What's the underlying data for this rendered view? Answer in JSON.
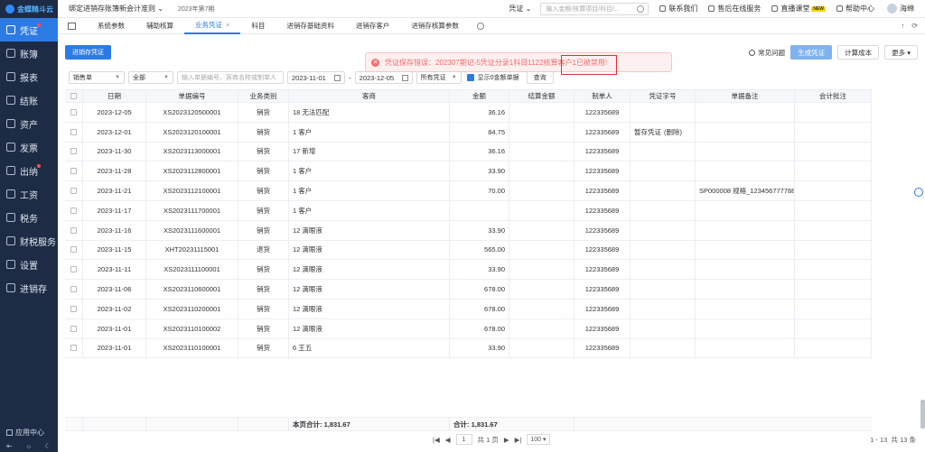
{
  "sidebar": {
    "logo": "金蝶精斗云",
    "items": [
      {
        "label": "凭证",
        "icon": "voucher-icon",
        "active": true,
        "dot": true
      },
      {
        "label": "账簿",
        "icon": "ledger-icon"
      },
      {
        "label": "报表",
        "icon": "report-icon"
      },
      {
        "label": "结账",
        "icon": "close-account-icon"
      },
      {
        "label": "资产",
        "icon": "asset-icon"
      },
      {
        "label": "发票",
        "icon": "invoice-icon"
      },
      {
        "label": "出纳",
        "icon": "cashier-icon",
        "dot": true
      },
      {
        "label": "工资",
        "icon": "salary-icon"
      },
      {
        "label": "税务",
        "icon": "tax-icon"
      },
      {
        "label": "财税服务",
        "icon": "service-icon"
      },
      {
        "label": "设置",
        "icon": "settings-icon"
      },
      {
        "label": "进销存",
        "icon": "inventory-icon"
      }
    ],
    "app_center": "应用中心"
  },
  "topbar": {
    "company": "绑定进销存账簿新会计准则",
    "period": "2023年第7期",
    "voucher_select": "凭证",
    "search_placeholder": "输入金额/核算项目/科目/...",
    "links": [
      "联系我们",
      "售后在线服务",
      "直播课堂",
      "帮助中心"
    ],
    "new_badge": "NEW",
    "user": "海绵"
  },
  "tabs": [
    {
      "label": "系统参数"
    },
    {
      "label": "辅助核算"
    },
    {
      "label": "业务凭证",
      "active": true,
      "close": "×"
    },
    {
      "label": "科目"
    },
    {
      "label": "进销存基础资料"
    },
    {
      "label": "进销存客户"
    },
    {
      "label": "进销存核算参数"
    }
  ],
  "toolbar": {
    "inventory_voucher": "进销存凭证",
    "faq": "常见问题",
    "generate": "生成凭证",
    "cost": "计算成本",
    "more": "更多"
  },
  "toast": {
    "message": "凭证保存错误：202307期记-5凭证分录1科目1122核算客户1已被禁用!"
  },
  "filters": {
    "type": "销售单",
    "scope": "全部",
    "search_placeholder": "输入单据编号、客商名称或制单人",
    "date_from": "2023-11-01",
    "date_sep": "-",
    "date_to": "2023-12-05",
    "status": "所有凭证",
    "show_zero": "显示0金额单据",
    "query": "查询"
  },
  "table": {
    "headers": [
      "日期",
      "单据编号",
      "业务类别",
      "客商",
      "金额",
      "结算金额",
      "制单人",
      "凭证字号",
      "单据备注",
      "会计批注"
    ],
    "rows": [
      {
        "date": "2023-12-05",
        "no": "XS2023120500001",
        "cat": "销货",
        "party": "18 无法匹配",
        "amount": "36.16",
        "settle": "",
        "maker": "122335689",
        "voucher": "",
        "note": "",
        "audit": ""
      },
      {
        "date": "2023-12-01",
        "no": "XS2023120100001",
        "cat": "销货",
        "party": "1 客户",
        "amount": "84.75",
        "settle": "",
        "maker": "122335689",
        "voucher": "暂存凭证",
        "voucher_del": "(删除)",
        "note": "",
        "audit": ""
      },
      {
        "date": "2023-11-30",
        "no": "XS2023113000001",
        "cat": "销货",
        "party": "17 新增",
        "amount": "36.16",
        "settle": "",
        "maker": "122335689",
        "voucher": "",
        "note": "",
        "audit": ""
      },
      {
        "date": "2023-11-28",
        "no": "XS2023112800001",
        "cat": "销货",
        "party": "1 客户",
        "amount": "33.90",
        "settle": "",
        "maker": "122335689",
        "voucher": "",
        "note": "",
        "audit": ""
      },
      {
        "date": "2023-11-21",
        "no": "XS2023112100001",
        "cat": "销货",
        "party": "1 客户",
        "amount": "70.00",
        "settle": "",
        "maker": "122335689",
        "voucher": "",
        "note": "SP000008 规格_123456777788",
        "audit": ""
      },
      {
        "date": "2023-11-17",
        "no": "XS2023111700001",
        "cat": "销货",
        "party": "1 客户",
        "amount": "",
        "settle": "",
        "maker": "122335689",
        "voucher": "",
        "note": "",
        "audit": ""
      },
      {
        "date": "2023-11-16",
        "no": "XS2023111600001",
        "cat": "销货",
        "party": "12 滴眼液",
        "amount": "33.90",
        "settle": "",
        "maker": "122335689",
        "voucher": "",
        "note": "",
        "audit": ""
      },
      {
        "date": "2023-11-15",
        "no": "XHT20231115001",
        "cat": "退货",
        "party": "12 滴眼液",
        "amount": "565.00",
        "settle": "",
        "maker": "122335689",
        "voucher": "",
        "note": "",
        "audit": ""
      },
      {
        "date": "2023-11-11",
        "no": "XS2023111100001",
        "cat": "销货",
        "party": "12 滴眼液",
        "amount": "33.90",
        "settle": "",
        "maker": "122335689",
        "voucher": "",
        "note": "",
        "audit": ""
      },
      {
        "date": "2023-11-06",
        "no": "XS2023110600001",
        "cat": "销货",
        "party": "12 滴眼液",
        "amount": "678.00",
        "settle": "",
        "maker": "122335689",
        "voucher": "",
        "note": "",
        "audit": ""
      },
      {
        "date": "2023-11-02",
        "no": "XS2023110200001",
        "cat": "销货",
        "party": "12 滴眼液",
        "amount": "678.00",
        "settle": "",
        "maker": "122335689",
        "voucher": "",
        "note": "",
        "audit": ""
      },
      {
        "date": "2023-11-01",
        "no": "XS2023110100002",
        "cat": "销货",
        "party": "12 滴眼液",
        "amount": "678.00",
        "settle": "",
        "maker": "122335689",
        "voucher": "",
        "note": "",
        "audit": ""
      },
      {
        "date": "2023-11-01",
        "no": "XS2023110100001",
        "cat": "销货",
        "party": "6 王五",
        "amount": "33.90",
        "settle": "",
        "maker": "122335689",
        "voucher": "",
        "note": "",
        "audit": ""
      }
    ],
    "page_total_label": "本页合计: 1,831.67",
    "grand_total_label": "合计: 1,831.67"
  },
  "pager": {
    "first": "|◀",
    "prev": "◀",
    "page": "1",
    "of_pages": "共 1 页",
    "next": "▶",
    "last": "▶|",
    "page_size": "100",
    "summary": "1 - 13",
    "total": "共 13 条"
  }
}
